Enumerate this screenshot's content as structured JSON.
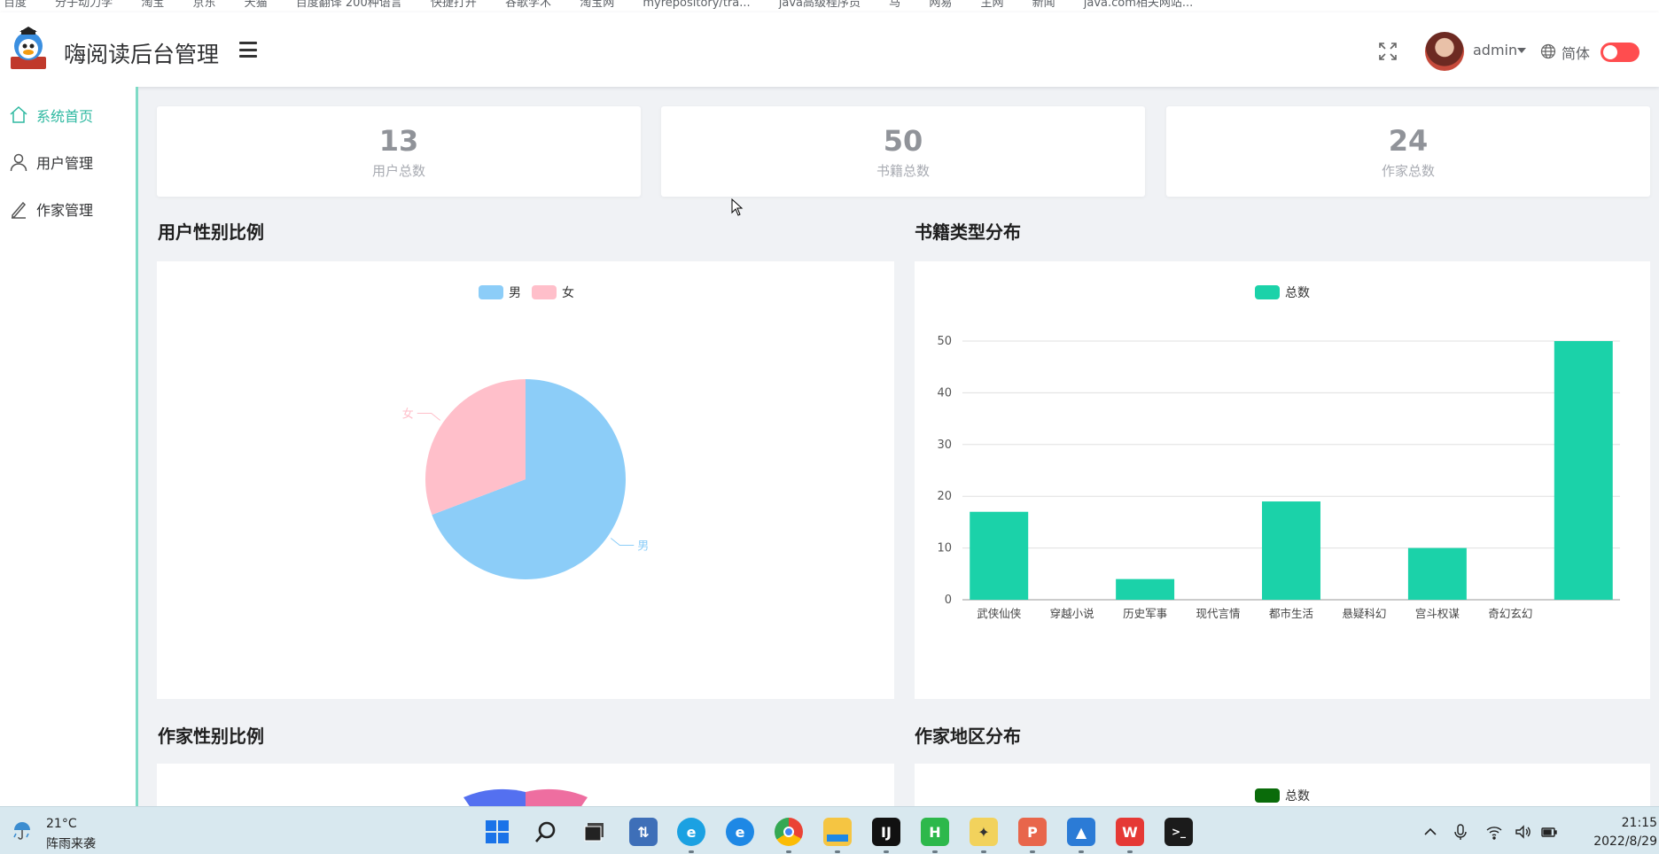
{
  "bookmarks": [
    "百度",
    "分子动力学",
    "淘宝",
    "京东",
    "天猫",
    "百度翻译 200种语言",
    "快捷打开",
    "谷歌学术",
    "淘宝网",
    "myrepository/tra...",
    "java高级程序员",
    "马",
    "网易",
    "主网",
    "新闻",
    "java.com相关网站..."
  ],
  "header": {
    "app_title": "嗨阅读后台管理",
    "user_name": "admin",
    "language": "简体"
  },
  "sidebar": {
    "items": [
      {
        "label": "系统首页",
        "icon": "home-icon",
        "active": true
      },
      {
        "label": "用户管理",
        "icon": "user-icon",
        "active": false
      },
      {
        "label": "作家管理",
        "icon": "pen-icon",
        "active": false
      }
    ]
  },
  "stats": [
    {
      "value": "13",
      "label": "用户总数"
    },
    {
      "value": "50",
      "label": "书籍总数"
    },
    {
      "value": "24",
      "label": "作家总数"
    }
  ],
  "sections": {
    "user_gender": "用户性别比例",
    "book_types": "书籍类型分布",
    "writer_gender": "作家性别比例",
    "writer_region": "作家地区分布"
  },
  "colors": {
    "accent": "#2fb9a1",
    "male": "#8ccdf8",
    "female": "#ffbfca",
    "bar": "#1bd2a9",
    "region_bar": "#0a6b0a",
    "toggle": "#ff4d4f"
  },
  "chart_data": [
    {
      "type": "pie",
      "title": "用户性别比例",
      "legend": [
        "男",
        "女"
      ],
      "labels": [
        "男",
        "女"
      ],
      "values": [
        9,
        4
      ],
      "legend_position": "top-center"
    },
    {
      "type": "bar",
      "title": "书籍类型分布",
      "legend": [
        "总数"
      ],
      "categories": [
        "武侠仙侠",
        "穿越小说",
        "历史军事",
        "现代言情",
        "都市生活",
        "悬疑科幻",
        "宫斗权谋",
        "奇幻玄幻",
        ""
      ],
      "series": [
        {
          "name": "总数",
          "values": [
            17,
            0,
            4,
            0,
            19,
            0,
            10,
            0,
            50
          ]
        }
      ],
      "ylim": [
        0,
        50
      ],
      "yticks": [
        0,
        10,
        20,
        30,
        40,
        50
      ],
      "grid": true,
      "legend_position": "top-center"
    },
    {
      "type": "bar",
      "title": "作家地区分布",
      "legend": [
        "总数"
      ],
      "legend_position": "top-center"
    }
  ],
  "taskbar": {
    "temperature": "21°C",
    "weather": "阵雨来袭",
    "time": "21:15",
    "date": "2022/8/29",
    "apps": [
      {
        "name": "start-icon"
      },
      {
        "name": "search-icon"
      },
      {
        "name": "task-view-icon"
      },
      {
        "name": "network-app-icon"
      },
      {
        "name": "edge-icon"
      },
      {
        "name": "ie-icon"
      },
      {
        "name": "chrome-icon"
      },
      {
        "name": "file-explorer-icon"
      },
      {
        "name": "intellij-icon"
      },
      {
        "name": "hbuilder-icon",
        "letter": "H"
      },
      {
        "name": "chat-app-icon"
      },
      {
        "name": "powerpoint-icon"
      },
      {
        "name": "photos-icon"
      },
      {
        "name": "wps-icon",
        "letter": "W"
      },
      {
        "name": "terminal-icon"
      }
    ]
  }
}
